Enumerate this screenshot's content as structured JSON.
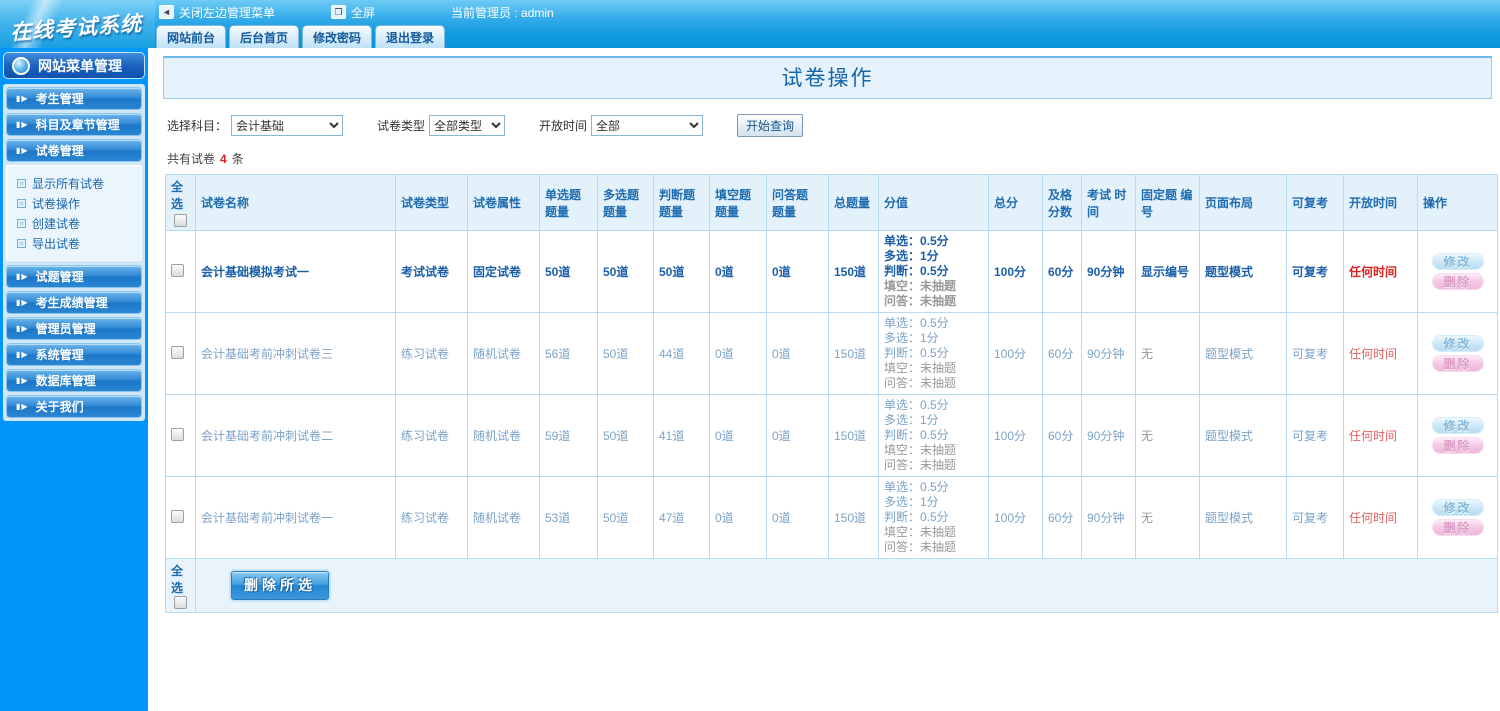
{
  "topbar": {
    "logo": "在线考试系统",
    "close_menu": "关闭左边管理菜单",
    "fullscreen": "全屏",
    "admin_label": "当前管理员 : admin",
    "tabs": [
      "网站前台",
      "后台首页",
      "修改密码",
      "退出登录"
    ]
  },
  "sidebar": {
    "header": "网站菜单管理",
    "groups": [
      {
        "label": "考生管理"
      },
      {
        "label": "科目及章节管理"
      },
      {
        "label": "试卷管理",
        "expanded": true,
        "items": [
          "显示所有试卷",
          "试卷操作",
          "创建试卷",
          "导出试卷"
        ]
      },
      {
        "label": "试题管理"
      },
      {
        "label": "考生成绩管理"
      },
      {
        "label": "管理员管理"
      },
      {
        "label": "系统管理"
      },
      {
        "label": "数据库管理"
      },
      {
        "label": "关于我们"
      }
    ]
  },
  "main": {
    "title": "试卷操作",
    "filters": {
      "subject_label": "选择科目：",
      "subject_value": "会计基础",
      "type_label": "试卷类型",
      "type_value": "全部类型",
      "time_label": "开放时间",
      "time_value": "全部",
      "search_button": "开始查询"
    },
    "count": {
      "prefix": "共有试卷",
      "num": "4",
      "suffix": "条"
    },
    "table": {
      "headers": [
        "全选",
        "试卷名称",
        "试卷类型",
        "试卷属性",
        "单选题 题量",
        "多选题 题量",
        "判断题 题量",
        "填空题 题量",
        "问答题 题量",
        "总题量",
        "分值",
        "总分",
        "及格 分数",
        "考试 时间",
        "固定题 编号",
        "页面布局",
        "可复考",
        "开放时间",
        "操作"
      ],
      "actions": {
        "edit": "修改",
        "delete": "删除"
      },
      "footer": {
        "select_all": "全选",
        "delete_button": "删除所选"
      },
      "rows": [
        {
          "name": "会计基础模拟考试一",
          "type": "考试试卷",
          "attr": "固定试卷",
          "q_single": "50道",
          "q_multi": "50道",
          "q_judge": "50道",
          "q_blank": "0道",
          "q_qa": "0道",
          "q_total": "150道",
          "score_lines": [
            {
              "text": "单选：0.5分",
              "muted": false
            },
            {
              "text": "多选：1分",
              "muted": false
            },
            {
              "text": "判断：0.5分",
              "muted": false
            },
            {
              "text": "填空：未抽题",
              "muted": true
            },
            {
              "text": "问答：未抽题",
              "muted": true
            }
          ],
          "total_score": "100分",
          "pass_score": "60分",
          "exam_time": "90分钟",
          "fixed_no": "显示编号",
          "fixed_no_muted": false,
          "page_layout": "题型模式",
          "retake": "可复考",
          "open_time": "任何时间",
          "strong": true
        },
        {
          "name": "会计基础考前冲刺试卷三",
          "type": "练习试卷",
          "attr": "随机试卷",
          "q_single": "56道",
          "q_multi": "50道",
          "q_judge": "44道",
          "q_blank": "0道",
          "q_qa": "0道",
          "q_total": "150道",
          "score_lines": [
            {
              "text": "单选：0.5分",
              "muted": false
            },
            {
              "text": "多选：1分",
              "muted": false
            },
            {
              "text": "判断：0.5分",
              "muted": false
            },
            {
              "text": "填空：未抽题",
              "muted": true
            },
            {
              "text": "问答：未抽题",
              "muted": true
            }
          ],
          "total_score": "100分",
          "pass_score": "60分",
          "exam_time": "90分钟",
          "fixed_no": "无",
          "fixed_no_muted": true,
          "page_layout": "题型模式",
          "retake": "可复考",
          "open_time": "任何时间",
          "strong": false
        },
        {
          "name": "会计基础考前冲刺试卷二",
          "type": "练习试卷",
          "attr": "随机试卷",
          "q_single": "59道",
          "q_multi": "50道",
          "q_judge": "41道",
          "q_blank": "0道",
          "q_qa": "0道",
          "q_total": "150道",
          "score_lines": [
            {
              "text": "单选：0.5分",
              "muted": false
            },
            {
              "text": "多选：1分",
              "muted": false
            },
            {
              "text": "判断：0.5分",
              "muted": false
            },
            {
              "text": "填空：未抽题",
              "muted": true
            },
            {
              "text": "问答：未抽题",
              "muted": true
            }
          ],
          "total_score": "100分",
          "pass_score": "60分",
          "exam_time": "90分钟",
          "fixed_no": "无",
          "fixed_no_muted": true,
          "page_layout": "题型模式",
          "retake": "可复考",
          "open_time": "任何时间",
          "strong": false
        },
        {
          "name": "会计基础考前冲刺试卷一",
          "type": "练习试卷",
          "attr": "随机试卷",
          "q_single": "53道",
          "q_multi": "50道",
          "q_judge": "47道",
          "q_blank": "0道",
          "q_qa": "0道",
          "q_total": "150道",
          "score_lines": [
            {
              "text": "单选：0.5分",
              "muted": false
            },
            {
              "text": "多选：1分",
              "muted": false
            },
            {
              "text": "判断：0.5分",
              "muted": false
            },
            {
              "text": "填空：未抽题",
              "muted": true
            },
            {
              "text": "问答：未抽题",
              "muted": true
            }
          ],
          "total_score": "100分",
          "pass_score": "60分",
          "exam_time": "90分钟",
          "fixed_no": "无",
          "fixed_no_muted": true,
          "page_layout": "题型模式",
          "retake": "可复考",
          "open_time": "任何时间",
          "strong": false
        }
      ]
    }
  }
}
